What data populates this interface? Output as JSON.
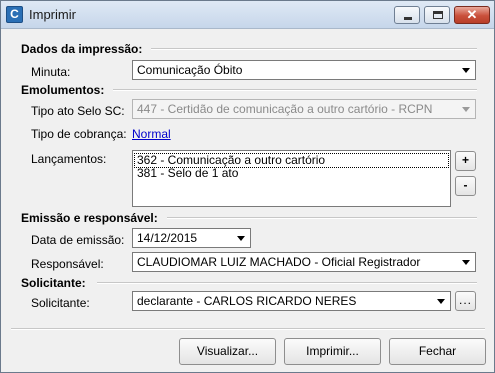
{
  "window": {
    "title": "Imprimir",
    "app_icon_letter": "C",
    "close_glyph": "✕"
  },
  "print_data": {
    "section": "Dados da impressão:",
    "minuta_label": "Minuta:",
    "minuta_value": "Comunicação Óbito"
  },
  "emolumentos": {
    "section": "Emolumentos:",
    "tipo_ato_label": "Tipo ato Selo SC:",
    "tipo_ato_value": "447 - Certidão de comunicação a outro cartório - RCPN",
    "cobranca_label": "Tipo de cobrança:",
    "cobranca_value": "Normal",
    "lancamentos_label": "Lançamentos:",
    "lancamentos": [
      "362 - Comunicação a outro cartório",
      "381 - Selo de 1 ato"
    ],
    "add_label": "+",
    "remove_label": "-"
  },
  "emissao": {
    "section": "Emissão e responsável:",
    "data_label": "Data de emissão:",
    "data_value": "14/12/2015",
    "responsavel_label": "Responsável:",
    "responsavel_value": "CLAUDIOMAR LUIZ MACHADO - Oficial Registrador"
  },
  "solicitante": {
    "section": "Solicitante:",
    "label": "Solicitante:",
    "value": "declarante - CARLOS RICARDO NERES",
    "browse_label": "..."
  },
  "buttons": {
    "visualizar": "Visualizar...",
    "imprimir": "Imprimir...",
    "fechar": "Fechar"
  }
}
